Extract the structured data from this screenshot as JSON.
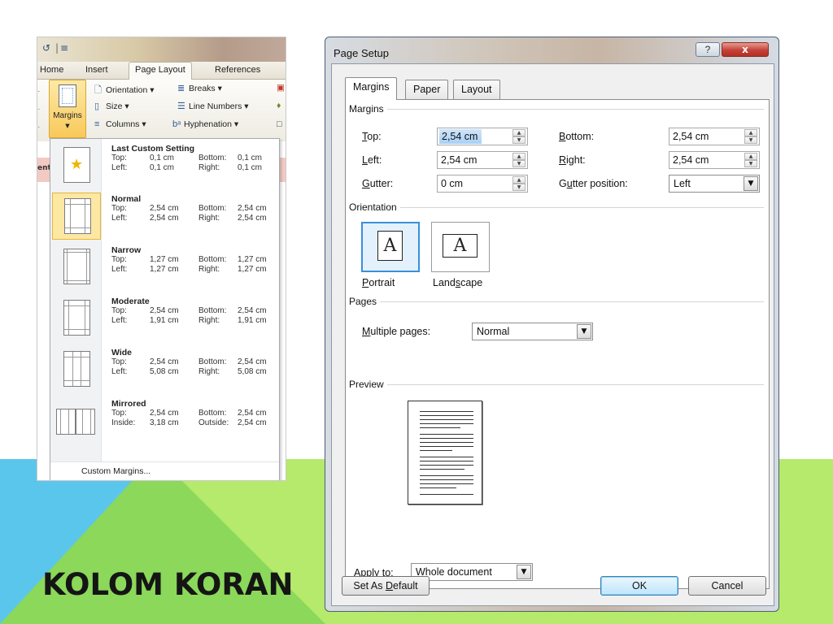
{
  "slide": {
    "title": "KOLOM KORAN",
    "colors": {
      "green": "#b5ea6c",
      "blue": "#5bc6ec",
      "mid_green": "#8bd85a"
    }
  },
  "word": {
    "qat_icons": [
      "undo-icon",
      "customize-qat-icon"
    ],
    "tabs": [
      "Home",
      "Insert",
      "Page Layout",
      "References"
    ],
    "active_tab": "Page Layout",
    "margins_button": "Margins",
    "ribbon_items": {
      "orientation": "Orientation ▾",
      "breaks": "Breaks ▾",
      "size": "Size ▾",
      "line_numbers": "Line Numbers ▾",
      "columns": "Columns ▾",
      "hyphenation": "Hyphenation ▾"
    },
    "side_text": "ent",
    "margin_options": [
      {
        "name": "Last Custom Setting",
        "r1a": "Top:",
        "r1b": "0,1 cm",
        "r1c": "Bottom:",
        "r1d": "0,1 cm",
        "r2a": "Left:",
        "r2b": "0,1 cm",
        "r2c": "Right:",
        "r2d": "0,1 cm"
      },
      {
        "name": "Normal",
        "r1a": "Top:",
        "r1b": "2,54 cm",
        "r1c": "Bottom:",
        "r1d": "2,54 cm",
        "r2a": "Left:",
        "r2b": "2,54 cm",
        "r2c": "Right:",
        "r2d": "2,54 cm"
      },
      {
        "name": "Narrow",
        "r1a": "Top:",
        "r1b": "1,27 cm",
        "r1c": "Bottom:",
        "r1d": "1,27 cm",
        "r2a": "Left:",
        "r2b": "1,27 cm",
        "r2c": "Right:",
        "r2d": "1,27 cm"
      },
      {
        "name": "Moderate",
        "r1a": "Top:",
        "r1b": "2,54 cm",
        "r1c": "Bottom:",
        "r1d": "2,54 cm",
        "r2a": "Left:",
        "r2b": "1,91 cm",
        "r2c": "Right:",
        "r2d": "1,91 cm"
      },
      {
        "name": "Wide",
        "r1a": "Top:",
        "r1b": "2,54 cm",
        "r1c": "Bottom:",
        "r1d": "2,54 cm",
        "r2a": "Left:",
        "r2b": "5,08 cm",
        "r2c": "Right:",
        "r2d": "5,08 cm"
      },
      {
        "name": "Mirrored",
        "r1a": "Top:",
        "r1b": "2,54 cm",
        "r1c": "Bottom:",
        "r1d": "2,54 cm",
        "r2a": "Inside:",
        "r2b": "3,18 cm",
        "r2c": "Outside:",
        "r2d": "2,54 cm"
      }
    ],
    "selected_option": "Normal",
    "custom_margins": "Custom Margins..."
  },
  "dialog": {
    "title": "Page Setup",
    "help": "?",
    "close": "x",
    "tabs": [
      "Margins",
      "Paper",
      "Layout"
    ],
    "active_tab": "Margins",
    "margins_group": "Margins",
    "top_label": "Top:",
    "top_value": "2,54 cm",
    "bottom_label": "Bottom:",
    "bottom_value": "2,54 cm",
    "left_label": "Left:",
    "left_value": "2,54 cm",
    "right_label": "Right:",
    "right_value": "2,54 cm",
    "gutter_label": "Gutter:",
    "gutter_value": "0 cm",
    "gutter_pos_label": "Gutter position:",
    "gutter_pos_value": "Left",
    "orientation_group": "Orientation",
    "portrait": "Portrait",
    "landscape": "Landscape",
    "orientation_letter": "A",
    "pages_group": "Pages",
    "multiple_pages_label": "Multiple pages:",
    "multiple_pages_value": "Normal",
    "preview_group": "Preview",
    "apply_to_label": "Apply to:",
    "apply_to_value": "Whole document",
    "set_default": "Set As Default",
    "ok": "OK",
    "cancel": "Cancel"
  }
}
